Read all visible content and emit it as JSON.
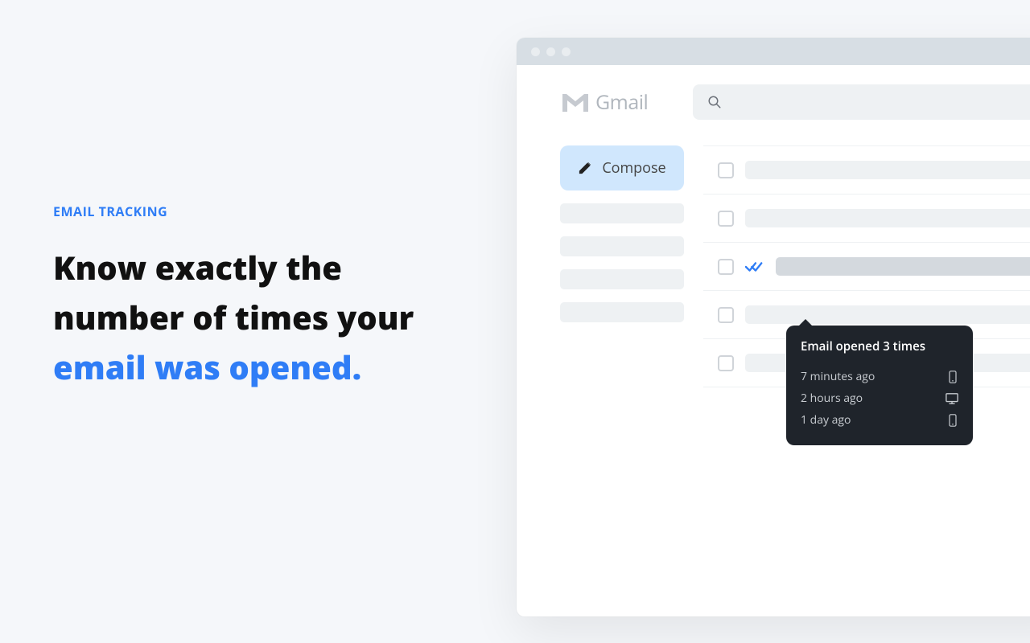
{
  "marketing": {
    "eyebrow": "EMAIL TRACKING",
    "headline_part1": "Know exactly the number of times your ",
    "headline_accent": "email was opened."
  },
  "app": {
    "logo_text": "Gmail",
    "compose_label": "Compose"
  },
  "tooltip": {
    "title": "Email opened 3 times",
    "rows": [
      {
        "time": "7 minutes ago",
        "device": "mobile"
      },
      {
        "time": "2 hours ago",
        "device": "desktop"
      },
      {
        "time": "1 day ago",
        "device": "mobile"
      }
    ]
  }
}
